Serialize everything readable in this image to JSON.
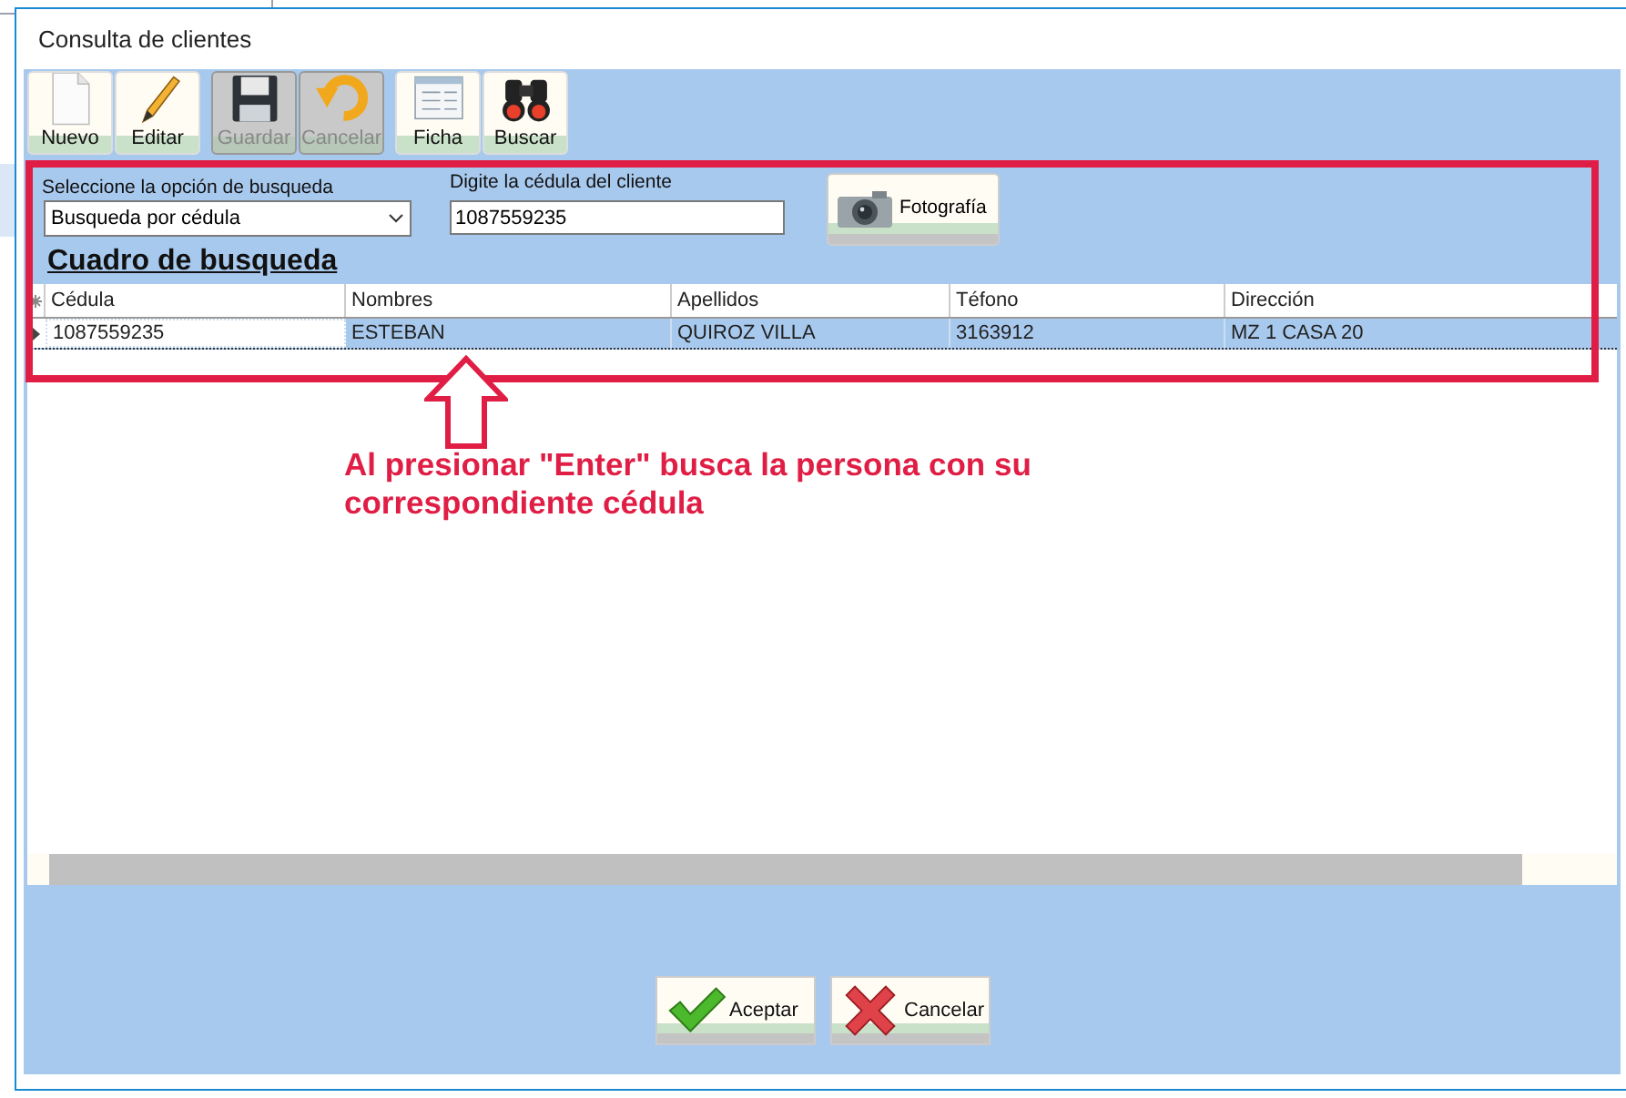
{
  "window": {
    "title": "Consulta de clientes"
  },
  "toolbar": [
    {
      "label": "Nuevo",
      "disabled": false
    },
    {
      "label": "Editar",
      "disabled": false
    },
    {
      "label": "Guardar",
      "disabled": true
    },
    {
      "label": "Cancelar",
      "disabled": true
    },
    {
      "label": "Ficha",
      "disabled": false
    },
    {
      "label": "Buscar",
      "disabled": false
    }
  ],
  "search": {
    "option_label": "Seleccione la opción de busqueda",
    "option_value": "Busqueda por cédula",
    "id_label": "Digite la cédula del cliente",
    "id_value": "1087559235",
    "photo_button": "Fotografía",
    "heading": "Cuadro de busqueda"
  },
  "table": {
    "columns": [
      "Cédula",
      "Nombres",
      "Apellidos",
      "Téfono",
      "Dirección"
    ],
    "rows": [
      {
        "cells": [
          "1087559235",
          "ESTEBAN",
          "QUIROZ VILLA",
          "3163912",
          "MZ 1 CASA 20"
        ],
        "selected": true
      }
    ]
  },
  "annotation": "Al presionar \"Enter\" busca la persona con su correspondiente cédula",
  "buttons": [
    {
      "label": "Aceptar",
      "kind": "ok"
    },
    {
      "label": "Cancelar",
      "kind": "cancel"
    }
  ]
}
